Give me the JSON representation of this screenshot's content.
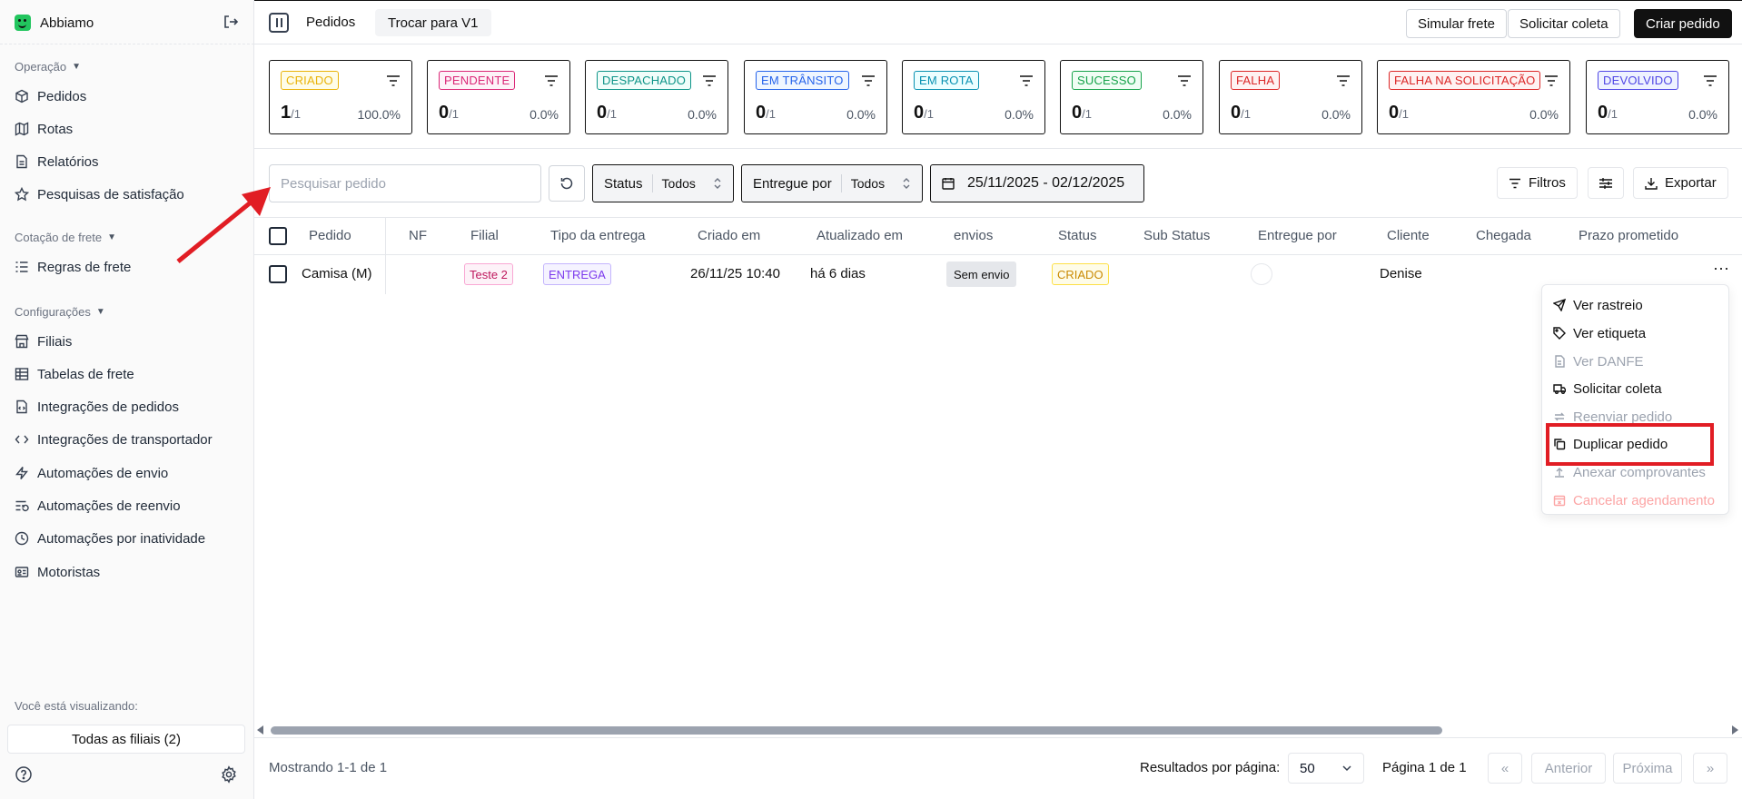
{
  "sidebar": {
    "brand": "Abbiamo",
    "sections": [
      {
        "title": "Operação",
        "items": [
          "Pedidos",
          "Rotas",
          "Relatórios",
          "Pesquisas de satisfação"
        ]
      },
      {
        "title": "Cotação de frete",
        "items": [
          "Regras de frete"
        ]
      },
      {
        "title": "Configurações",
        "items": [
          "Filiais",
          "Tabelas de frete",
          "Integrações de pedidos",
          "Integrações de transportador",
          "Automações de envio",
          "Automações de reenvio",
          "Automações por inatividade",
          "Motoristas"
        ]
      }
    ],
    "viewing_label": "Você está visualizando:",
    "branch_selector": "Todas as filiais (2)"
  },
  "topbar": {
    "title": "Pedidos",
    "switch_label": "Trocar para V1",
    "simulate_label": "Simular frete",
    "request_label": "Solicitar coleta",
    "create_label": "Criar pedido"
  },
  "status_cards": [
    {
      "label": "CRIADO",
      "count": "1",
      "total": "/1",
      "percent": "100.0%",
      "color": "#eab308",
      "bg": "#fefce8"
    },
    {
      "label": "PENDENTE",
      "count": "0",
      "total": "/1",
      "percent": "0.0%",
      "color": "#db2777",
      "bg": "#fdf2f8"
    },
    {
      "label": "DESPACHADO",
      "count": "0",
      "total": "/1",
      "percent": "0.0%",
      "color": "#0d9488",
      "bg": "#f0fdfa"
    },
    {
      "label": "EM TRÂNSITO",
      "count": "0",
      "total": "/1",
      "percent": "0.0%",
      "color": "#2563eb",
      "bg": "#eff6ff"
    },
    {
      "label": "EM ROTA",
      "count": "0",
      "total": "/1",
      "percent": "0.0%",
      "color": "#0891b2",
      "bg": "#ecfeff"
    },
    {
      "label": "SUCESSO",
      "count": "0",
      "total": "/1",
      "percent": "0.0%",
      "color": "#16a34a",
      "bg": "#f0fdf4"
    },
    {
      "label": "FALHA",
      "count": "0",
      "total": "/1",
      "percent": "0.0%",
      "color": "#dc2626",
      "bg": "#fef2f2"
    },
    {
      "label": "FALHA NA SOLICITAÇÃO",
      "count": "0",
      "total": "/1",
      "percent": "0.0%",
      "color": "#dc2626",
      "bg": "#fef2f2"
    },
    {
      "label": "DEVOLVIDO",
      "count": "0",
      "total": "/1",
      "percent": "0.0%",
      "color": "#4f46e5",
      "bg": "#eef2ff"
    }
  ],
  "filters": {
    "search_placeholder": "Pesquisar pedido",
    "status_label": "Status",
    "status_value": "Todos",
    "delivered_label": "Entregue por",
    "delivered_value": "Todos",
    "date_range": "25/11/2025 - 02/12/2025",
    "filters_label": "Filtros",
    "export_label": "Exportar"
  },
  "table": {
    "columns": [
      "Pedido",
      "NF",
      "Filial",
      "Tipo da entrega",
      "Criado em",
      "Atualizado em",
      "envios",
      "Status",
      "Sub Status",
      "Entregue por",
      "Cliente",
      "Chegada",
      "Prazo prometido"
    ],
    "rows": [
      {
        "pedido": "Camisa (M)",
        "nf": "",
        "filial": "Teste 2",
        "tipo": "ENTREGA",
        "criado": "26/11/25 10:40",
        "atualizado": "há 6 dias",
        "envios": "Sem envio",
        "status": "CRIADO",
        "cliente": "Denise"
      }
    ]
  },
  "context_menu": {
    "items": [
      {
        "label": "Ver rastreio",
        "icon": "send-icon",
        "state": "enabled"
      },
      {
        "label": "Ver etiqueta",
        "icon": "tag-icon",
        "state": "enabled"
      },
      {
        "label": "Ver DANFE",
        "icon": "file-icon",
        "state": "disabled"
      },
      {
        "label": "Solicitar coleta",
        "icon": "truck-icon",
        "state": "enabled"
      },
      {
        "label": "Reenviar pedido",
        "icon": "repeat-icon",
        "state": "disabled"
      },
      {
        "label": "Duplicar pedido",
        "icon": "copy-icon",
        "state": "enabled"
      },
      {
        "label": "Anexar comprovantes",
        "icon": "upload-icon",
        "state": "disabled"
      },
      {
        "label": "Cancelar agendamento",
        "icon": "calendar-x-icon",
        "state": "danger-disabled"
      }
    ]
  },
  "footer": {
    "showing": "Mostrando 1-1 de 1",
    "per_page_label": "Resultados por página:",
    "per_page_value": "50",
    "page_info": "Página 1 de 1",
    "first": "«",
    "prev": "Anterior",
    "next": "Próxima",
    "last": "»"
  },
  "annotations": {
    "highlight_color": "#e11d24"
  }
}
